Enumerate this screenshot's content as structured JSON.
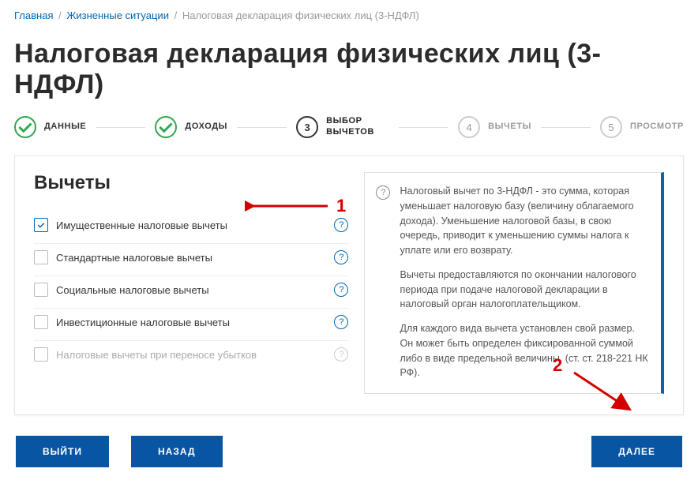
{
  "breadcrumb": {
    "home": "Главная",
    "situations": "Жизненные ситуации",
    "current": "Налоговая декларация физических лиц (3-НДФЛ)"
  },
  "page_title": "Налоговая декларация физических лиц (3-НДФЛ)",
  "stepper": {
    "s1": {
      "num": "✓",
      "label": "ДАННЫЕ",
      "state": "done"
    },
    "s2": {
      "num": "✓",
      "label": "ДОХОДЫ",
      "state": "done"
    },
    "s3": {
      "num": "3",
      "label": "ВЫБОР ВЫЧЕТОВ",
      "state": "active"
    },
    "s4": {
      "num": "4",
      "label": "ВЫЧЕТЫ",
      "state": "upcoming"
    },
    "s5": {
      "num": "5",
      "label": "ПРОСМОТР",
      "state": "upcoming"
    }
  },
  "section_title": "Вычеты",
  "deductions": {
    "d1": {
      "label": "Имущественные налоговые вычеты",
      "checked": true
    },
    "d2": {
      "label": "Стандартные налоговые вычеты",
      "checked": false
    },
    "d3": {
      "label": "Социальные налоговые вычеты",
      "checked": false
    },
    "d4": {
      "label": "Инвестиционные налоговые вычеты",
      "checked": false
    },
    "d5": {
      "label": "Налоговые вычеты при переносе убытков",
      "checked": false
    }
  },
  "info": {
    "p1": "Налоговый вычет по 3-НДФЛ - это сумма, которая уменьшает налоговую базу (величину облагаемого дохода). Уменьшение налоговой базы, в свою очередь, приводит к уменьшению суммы налога к уплате или его возврату.",
    "p2": "Вычеты предоставляются по окончании налогового периода при подаче налоговой декларации в налоговый орган налогоплательщиком.",
    "p3": "Для каждого вида вычета установлен свой размер. Он может быть определен фиксированной суммой либо в виде предельной величины. (ст. ст. 218-221 НК РФ)."
  },
  "buttons": {
    "exit": "ВЫЙТИ",
    "back": "НАЗАД",
    "next": "ДАЛЕЕ"
  },
  "annotations": {
    "a1": "1",
    "a2": "2"
  },
  "colors": {
    "primary": "#0855a3",
    "accent_green": "#2fa84f",
    "anno": "#d40000"
  }
}
